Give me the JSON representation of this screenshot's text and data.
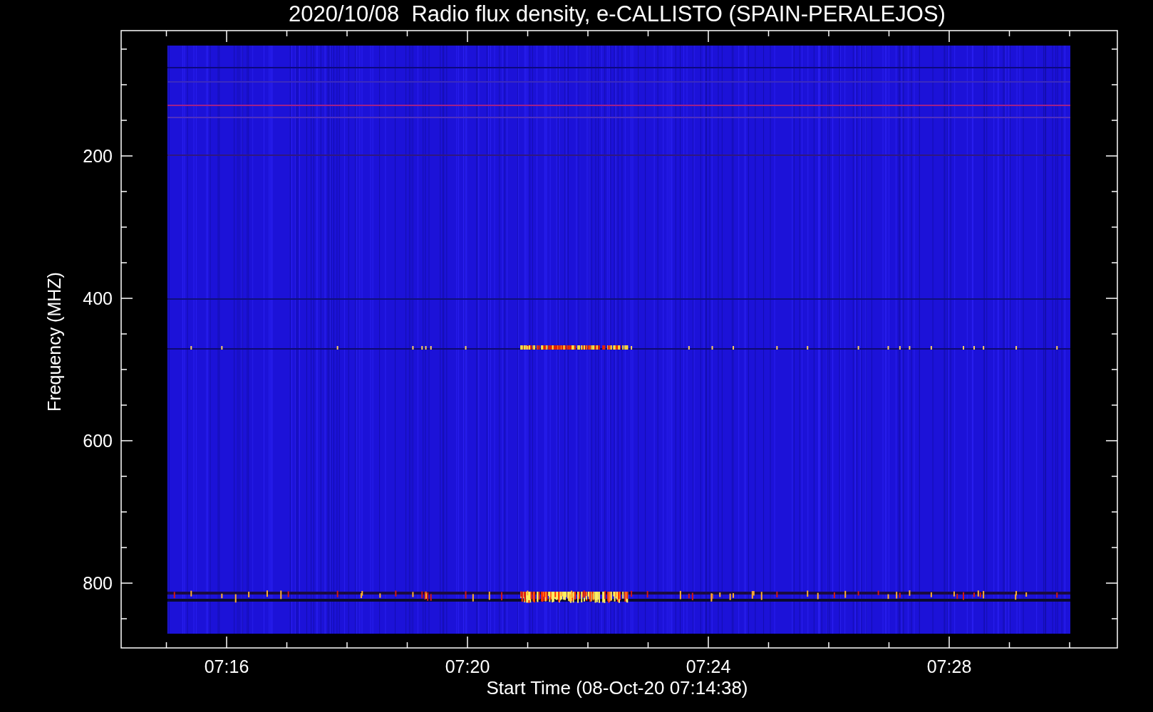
{
  "title": "2020/10/08  Radio flux density, e-CALLISTO (SPAIN-PERALEJOS)",
  "y_axis": {
    "label": "Frequency (MHZ)",
    "ticks": [
      "200",
      "400",
      "600",
      "800"
    ]
  },
  "x_axis": {
    "label": "Start Time (08-Oct-20 07:14:38)",
    "ticks": [
      "07:16",
      "07:20",
      "07:24",
      "07:28"
    ]
  }
}
